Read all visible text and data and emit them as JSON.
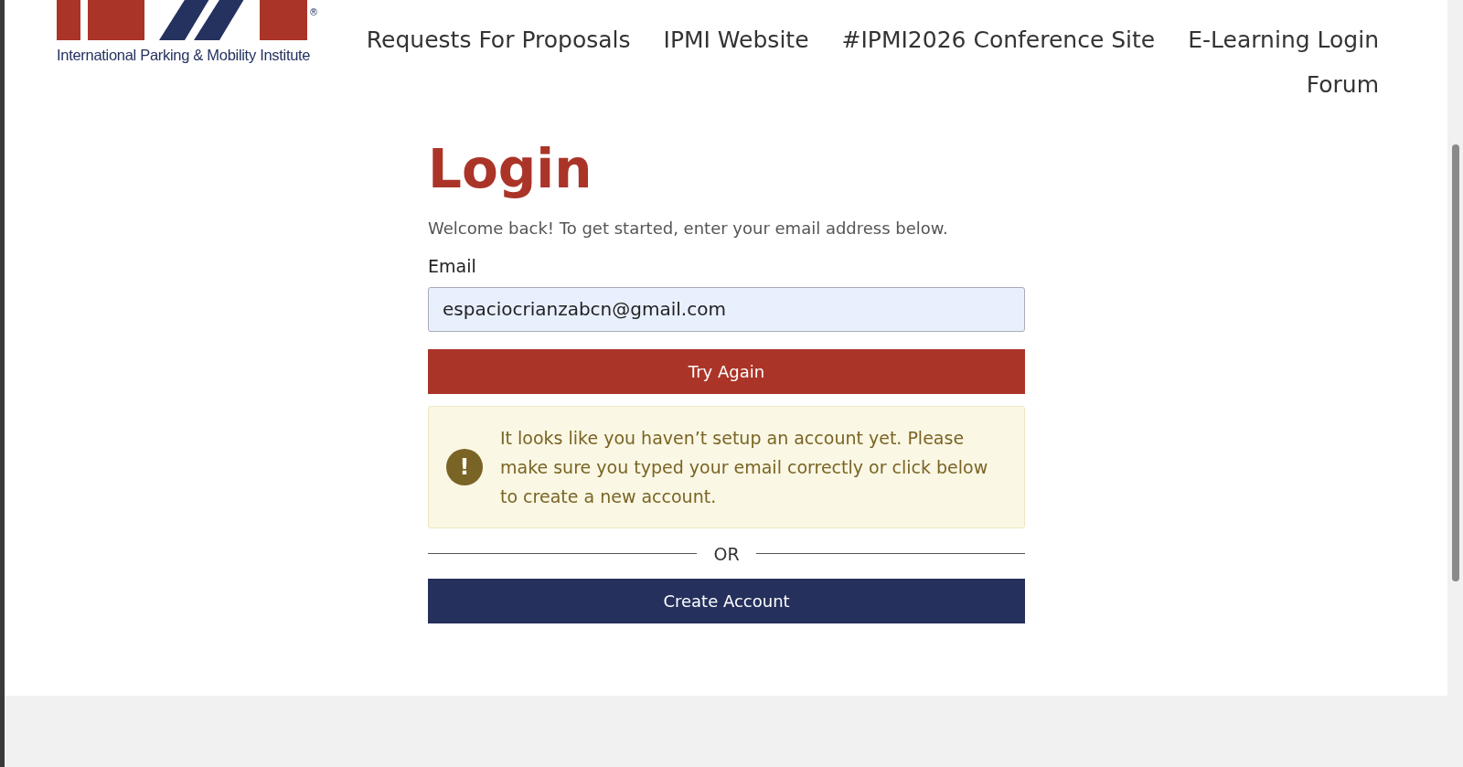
{
  "logo": {
    "tagline": "International Parking & Mobility Institute",
    "registered": "®"
  },
  "nav": [
    {
      "label": "Requests For Proposals"
    },
    {
      "label": "IPMI Website"
    },
    {
      "label": "#IPMI2026 Conference Site"
    },
    {
      "label": "E-Learning Login"
    },
    {
      "label": "Forum"
    }
  ],
  "login": {
    "title": "Login",
    "intro": "Welcome back! To get started, enter your email address below.",
    "email_label": "Email",
    "email_value": "espaciocrianzabcn@gmail.com",
    "submit": "Try Again",
    "alert": {
      "icon": "!",
      "text": "It looks like you haven’t setup an account yet. Please make sure you typed your email correctly or click below to create a new account."
    },
    "divider": "OR",
    "create": "Create Account"
  }
}
